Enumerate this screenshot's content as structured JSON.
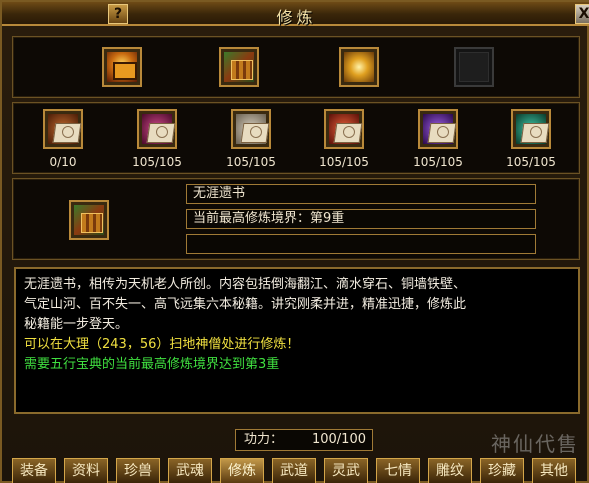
{
  "window": {
    "title": "修炼",
    "help_label": "?",
    "close_label": "X"
  },
  "top_items": [
    {
      "name": "gold-book-icon"
    },
    {
      "name": "green-chest-icon"
    },
    {
      "name": "treasure-pile-icon"
    },
    {
      "name": "empty-slot-icon"
    }
  ],
  "skill_books": [
    {
      "count": "0/10"
    },
    {
      "count": "105/105"
    },
    {
      "count": "105/105"
    },
    {
      "count": "105/105"
    },
    {
      "count": "105/105"
    },
    {
      "count": "105/105"
    }
  ],
  "selected": {
    "name": "无涯遗书",
    "realm": "当前最高修炼境界：第9重",
    "extra": ""
  },
  "description": {
    "line1": "无涯遗书，相传为天机老人所创。内容包括倒海翻江、滴水穿石、铜墙铁壁、",
    "line2": "气定山河、百不失一、高飞远集六本秘籍。讲究刚柔并进，精准迅捷，修炼此",
    "line3": "秘籍能一步登天。",
    "location": "可以在大理（243，56）扫地神僧处进行修炼！",
    "requirement": "需要五行宝典的当前最高修炼境界达到第3重"
  },
  "power": {
    "label": "功力：",
    "value": "100/100"
  },
  "tabs": [
    "装备",
    "资料",
    "珍兽",
    "武魂",
    "修炼",
    "武道",
    "灵武",
    "七情",
    "雕纹",
    "珍藏",
    "其他"
  ],
  "active_tab": "修炼",
  "watermark": "神仙代售",
  "colors": {
    "gold_border": "#b8893a",
    "text_yellow": "#f0e040",
    "text_green": "#40e040"
  }
}
